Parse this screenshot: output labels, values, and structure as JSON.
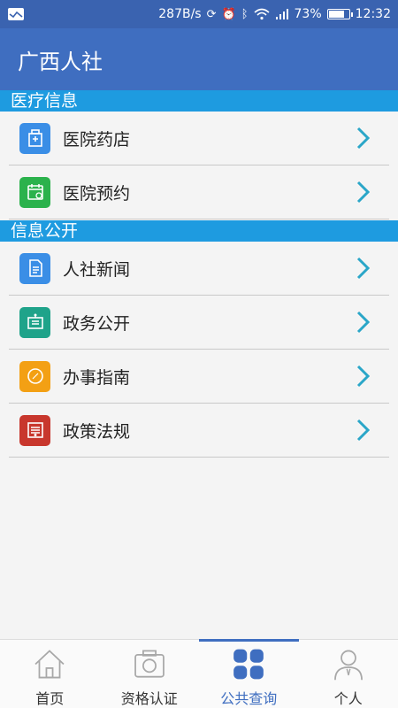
{
  "status": {
    "speed": "287B/s",
    "battery": "73%",
    "time": "12:32"
  },
  "app": {
    "title": "广西人社"
  },
  "sections": [
    {
      "title": "医疗信息",
      "items": [
        {
          "label": "医院药店",
          "icon": "hospital-icon",
          "color": "#3a8ee6"
        },
        {
          "label": "医院预约",
          "icon": "calendar-icon",
          "color": "#2bb24c"
        }
      ]
    },
    {
      "title": "信息公开",
      "items": [
        {
          "label": "人社新闻",
          "icon": "document-icon",
          "color": "#3a8ee6"
        },
        {
          "label": "政务公开",
          "icon": "notice-board-icon",
          "color": "#1fa38a"
        },
        {
          "label": "办事指南",
          "icon": "compass-icon",
          "color": "#f3a014"
        },
        {
          "label": "政策法规",
          "icon": "regulation-icon",
          "color": "#c8372d"
        }
      ]
    }
  ],
  "nav": [
    {
      "label": "首页",
      "icon": "home-icon",
      "active": false
    },
    {
      "label": "资格认证",
      "icon": "camera-icon",
      "active": false
    },
    {
      "label": "公共查询",
      "icon": "grid-icon",
      "active": true
    },
    {
      "label": "个人",
      "icon": "person-icon",
      "active": false
    }
  ],
  "colors": {
    "primary": "#3f6ec0",
    "status_bar": "#3a63b0",
    "section_header": "#1e9be0",
    "chevron": "#2aa6c8"
  }
}
